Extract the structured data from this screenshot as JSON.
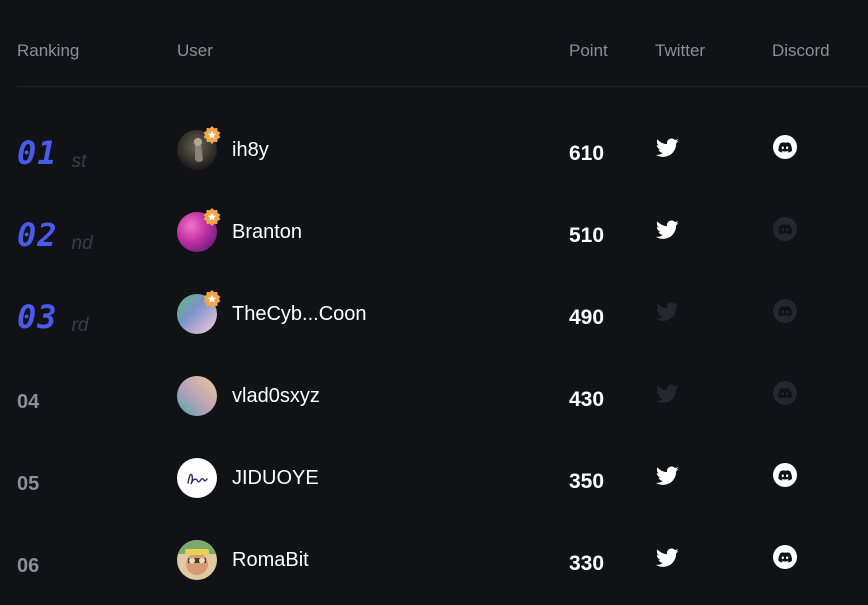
{
  "header": {
    "ranking": "Ranking",
    "user": "User",
    "point": "Point",
    "twitter": "Twitter",
    "discord": "Discord"
  },
  "colors": {
    "background": "#111216",
    "accent_rank": "#4a5bec",
    "muted_text": "#8b8f99",
    "badge": "#f0a64a",
    "icon_active": "#ffffff",
    "icon_inactive": "#25272d"
  },
  "rows": [
    {
      "rank": "01",
      "suffix": "st",
      "user": "ih8y",
      "points": "610",
      "badge": true,
      "twitter": true,
      "discord": true,
      "avatar_icon": "photo-avatar"
    },
    {
      "rank": "02",
      "suffix": "nd",
      "user": "Branton",
      "points": "510",
      "badge": true,
      "twitter": true,
      "discord": false,
      "avatar_icon": "gradient-avatar"
    },
    {
      "rank": "03",
      "suffix": "rd",
      "user": "TheCyb...Coon",
      "points": "490",
      "badge": true,
      "twitter": false,
      "discord": false,
      "avatar_icon": "gradient-avatar"
    },
    {
      "rank": "04",
      "suffix": "",
      "user": "vlad0sxyz",
      "points": "430",
      "badge": false,
      "twitter": false,
      "discord": false,
      "avatar_icon": "gradient-avatar"
    },
    {
      "rank": "05",
      "suffix": "",
      "user": "JIDUOYE",
      "points": "350",
      "badge": false,
      "twitter": true,
      "discord": true,
      "avatar_icon": "signature-avatar"
    },
    {
      "rank": "06",
      "suffix": "",
      "user": "RomaBit",
      "points": "330",
      "badge": false,
      "twitter": true,
      "discord": true,
      "avatar_icon": "photo-avatar"
    }
  ]
}
